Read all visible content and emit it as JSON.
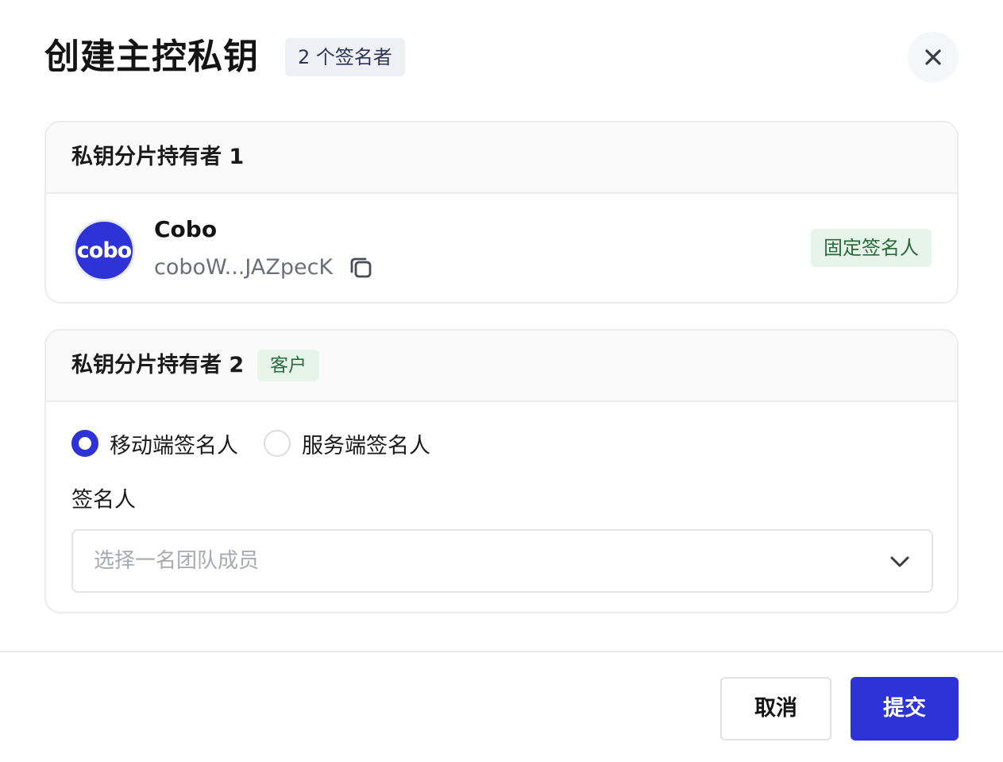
{
  "header": {
    "title": "创建主控私钥",
    "signer_count_badge": "2 个签名者",
    "close_icon": "close-icon"
  },
  "holder1": {
    "heading": "私钥分片持有者 1",
    "avatar_text": "cobo",
    "name": "Cobo",
    "address": "coboW...JAZpecK",
    "copy_icon": "copy-icon",
    "badge": "固定签名人"
  },
  "holder2": {
    "heading": "私钥分片持有者 2",
    "badge": "客户",
    "radio_options": [
      {
        "label": "移动端签名人",
        "checked": true
      },
      {
        "label": "服务端签名人",
        "checked": false
      }
    ],
    "field_label": "签名人",
    "select_placeholder": "选择一名团队成员",
    "chevron_icon": "chevron-down-icon"
  },
  "footer": {
    "cancel_label": "取消",
    "submit_label": "提交"
  },
  "colors": {
    "primary": "#2d33d6",
    "badge_green_bg": "#e6f4ea",
    "badge_green_text": "#2b6a3d",
    "badge_gray_bg": "#eff0f5"
  }
}
